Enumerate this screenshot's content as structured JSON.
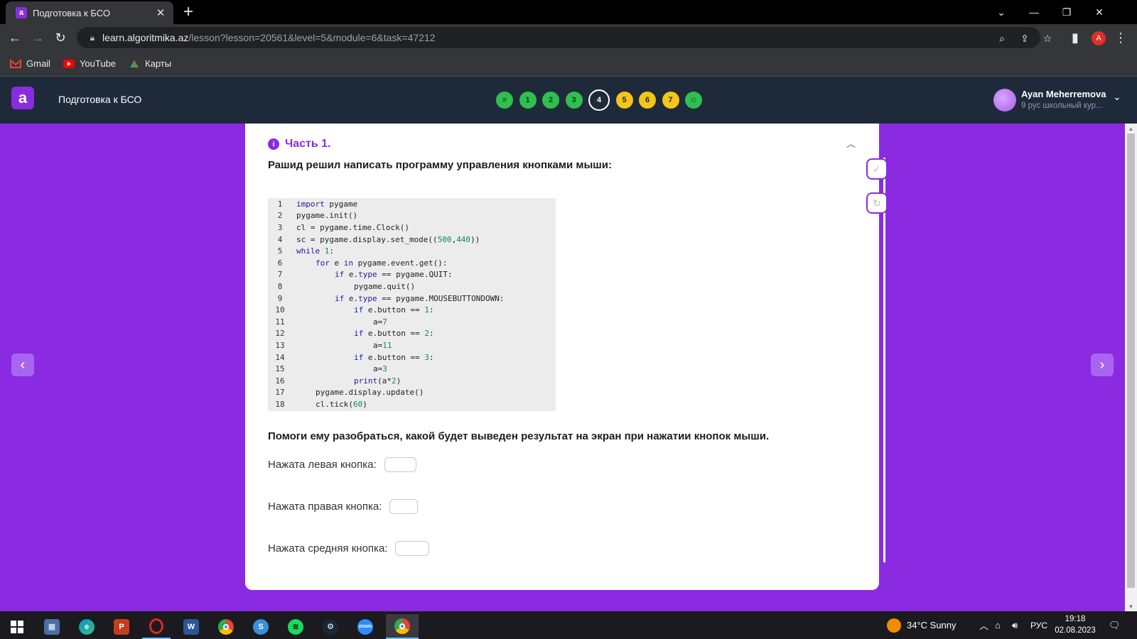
{
  "browser": {
    "tab_title": "Подготовка к БСО",
    "url_host": "learn.algoritmika.az",
    "url_path": "/lesson?lesson=20561&level=5&module=6&task=47212",
    "profile_initial": "A",
    "bookmarks": [
      {
        "label": "Gmail",
        "icon": "gmail-icon"
      },
      {
        "label": "YouTube",
        "icon": "youtube-icon"
      },
      {
        "label": "Карты",
        "icon": "maps-icon"
      }
    ]
  },
  "site": {
    "logo_letter": "a",
    "course_title": "Подготовка к БСО",
    "steps": [
      {
        "label": "",
        "state": "done",
        "icon": "notes-icon"
      },
      {
        "label": "1",
        "state": "done"
      },
      {
        "label": "2",
        "state": "done"
      },
      {
        "label": "3",
        "state": "done"
      },
      {
        "label": "4",
        "state": "current"
      },
      {
        "label": "5",
        "state": "todo"
      },
      {
        "label": "6",
        "state": "todo"
      },
      {
        "label": "7",
        "state": "todo"
      },
      {
        "label": "",
        "state": "done",
        "icon": "smile-icon"
      }
    ],
    "user_name": "Ayan Meherremova",
    "user_sub": "9 рус школьный кур..."
  },
  "task": {
    "part_title": "Часть 1.",
    "question1": "Рашид решил написать программу управления кнопками мыши:",
    "code": [
      {
        "n": "1",
        "indent": 0,
        "html": "<span class='kw'>import</span> pygame"
      },
      {
        "n": "2",
        "indent": 0,
        "html": "pygame.init()"
      },
      {
        "n": "3",
        "indent": 0,
        "html": "cl = pygame.time.Clock()"
      },
      {
        "n": "4",
        "indent": 0,
        "html": "sc = pygame.display.set_mode((<span class='num'>500</span>,<span class='num'>440</span>))"
      },
      {
        "n": "5",
        "indent": 0,
        "html": "<span class='kw'>while</span> <span class='num'>1</span>:"
      },
      {
        "n": "6",
        "indent": 1,
        "html": "<span class='kw'>for</span> e <span class='kw'>in</span> pygame.event.get():"
      },
      {
        "n": "7",
        "indent": 2,
        "html": "<span class='kw'>if</span> e.<span class='kw'>type</span> == pygame.QUIT:"
      },
      {
        "n": "8",
        "indent": 3,
        "html": "pygame.quit()"
      },
      {
        "n": "9",
        "indent": 2,
        "html": "<span class='kw'>if</span> e.<span class='kw'>type</span> == pygame.MOUSEBUTTONDOWN:"
      },
      {
        "n": "10",
        "indent": 3,
        "html": "<span class='kw'>if</span> e.button == <span class='num'>1</span>:"
      },
      {
        "n": "11",
        "indent": 4,
        "html": "a=<span class='num'>7</span>"
      },
      {
        "n": "12",
        "indent": 3,
        "html": "<span class='kw'>if</span> e.button == <span class='num'>2</span>:"
      },
      {
        "n": "13",
        "indent": 4,
        "html": "a=<span class='num'>11</span>"
      },
      {
        "n": "14",
        "indent": 3,
        "html": "<span class='kw'>if</span> e.button == <span class='num'>3</span>:"
      },
      {
        "n": "15",
        "indent": 4,
        "html": "a=<span class='num'>3</span>"
      },
      {
        "n": "16",
        "indent": 3,
        "html": "<span class='kw'>print</span>(a*<span class='num'>2</span>)"
      },
      {
        "n": "17",
        "indent": 1,
        "html": "pygame.display.update()"
      },
      {
        "n": "18",
        "indent": 1,
        "html": "cl.tick(<span class='num'>60</span>)"
      }
    ],
    "question2": "Помоги ему разобраться, какой будет выведен результат на экран при нажатии кнопок мыши.",
    "answers": [
      {
        "label": "Нажата левая кнопка:",
        "value": ""
      },
      {
        "label": "Нажата правая кнопка:",
        "value": ""
      },
      {
        "label": "Нажата средняя кнопка:",
        "value": ""
      }
    ]
  },
  "taskbar": {
    "weather": "34°C  Sunny",
    "lang": "РУС",
    "time": "19:18",
    "date": "02.08.2023",
    "apps": [
      "calculator-icon",
      "edge-icon",
      "powerpoint-icon",
      "opera-icon",
      "word-icon",
      "chrome-icon",
      "skype-icon",
      "spotify-icon",
      "steam-icon",
      "zoom-icon",
      "chrome-icon"
    ]
  },
  "colors": {
    "brand_purple": "#8a2be2",
    "header_dark": "#1e2a3a",
    "step_done": "#2fbf4f",
    "step_todo": "#f5c518"
  }
}
